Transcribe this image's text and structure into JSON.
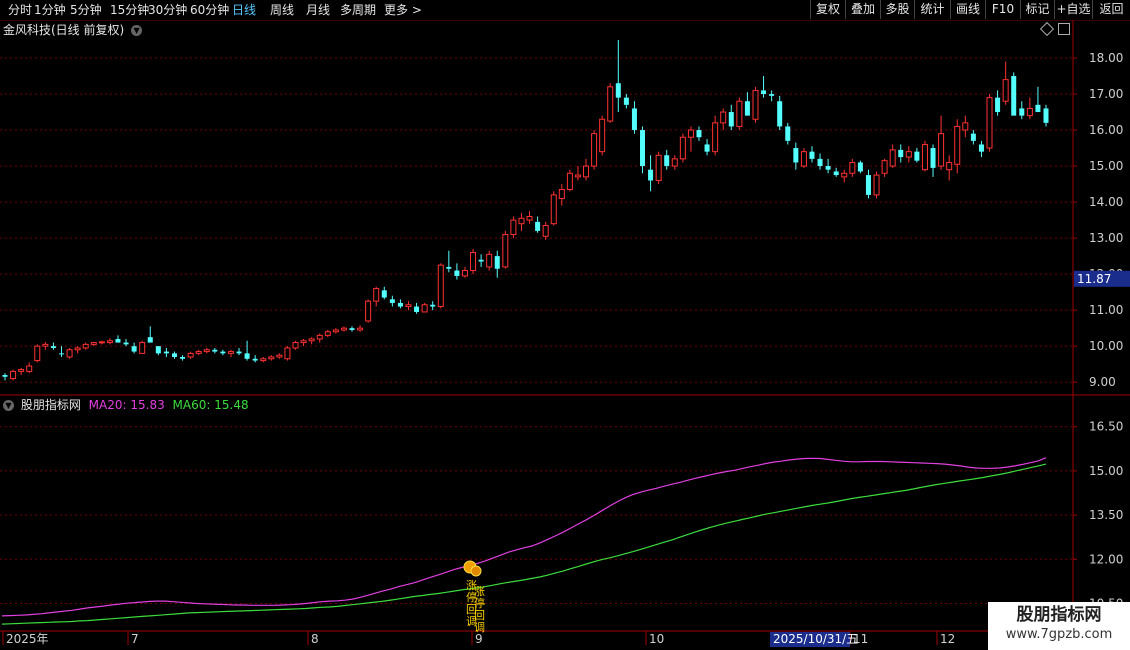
{
  "toolbar": {
    "periods": [
      "分时",
      "1分钟",
      "5分钟",
      "15分钟",
      "30分钟",
      "60分钟",
      "日线",
      "周线",
      "月线",
      "多周期",
      "更多 >"
    ],
    "active_period": "日线",
    "buttons": [
      "复权",
      "叠加",
      "多股",
      "统计",
      "画线",
      "F10",
      "标记",
      "+自选",
      "返回"
    ]
  },
  "stock_title": "金风科技(日线 前复权)",
  "indicator": {
    "name": "股朋指标网",
    "ma20_label": "MA20: 15.83",
    "ma60_label": "MA60: 15.48"
  },
  "colors": {
    "up": "#ff3232",
    "down": "#54ffff",
    "ma20": "#e040e0",
    "ma60": "#3cdc3c",
    "grid": "#6a0000",
    "axis_text": "#d0d0d0",
    "signal": "#ffd200"
  },
  "price_axis": {
    "labels": [
      "18.00",
      "17.00",
      "16.00",
      "15.00",
      "14.00",
      "13.00",
      "12.00",
      "11.00",
      "10.00",
      "9.00"
    ],
    "min": 8.7,
    "max": 18.5,
    "current_price": "11.87"
  },
  "indicator_axis": {
    "labels": [
      "16.50",
      "15.00",
      "13.50",
      "12.00",
      "10.50"
    ],
    "min": 9.6,
    "max": 17.0
  },
  "time_axis": [
    "2025年",
    "7",
    "8",
    "9",
    "10",
    "11",
    "12"
  ],
  "cursor_date": "2025/10/31/五",
  "signal_text": [
    "涨",
    "停",
    "回",
    "调"
  ],
  "watermark": {
    "name": "股朋指标网",
    "url": "www.7gpzb.com"
  },
  "chart_data": {
    "type": "candlestick",
    "candles": [
      [
        9.2,
        9.25,
        9.05,
        9.15
      ],
      [
        9.1,
        9.35,
        9.05,
        9.3
      ],
      [
        9.3,
        9.4,
        9.2,
        9.35
      ],
      [
        9.3,
        9.55,
        9.25,
        9.45
      ],
      [
        9.6,
        10.05,
        9.55,
        10.0
      ],
      [
        10.0,
        10.12,
        9.9,
        10.05
      ],
      [
        10.0,
        10.1,
        9.9,
        9.95
      ],
      [
        9.8,
        10.0,
        9.7,
        9.78
      ],
      [
        9.7,
        9.95,
        9.65,
        9.9
      ],
      [
        9.9,
        10.0,
        9.8,
        9.95
      ],
      [
        9.95,
        10.1,
        9.9,
        10.05
      ],
      [
        10.05,
        10.12,
        10.0,
        10.1
      ],
      [
        10.1,
        10.15,
        10.05,
        10.12
      ],
      [
        10.1,
        10.22,
        10.05,
        10.15
      ],
      [
        10.2,
        10.3,
        10.1,
        10.1
      ],
      [
        10.1,
        10.2,
        10.0,
        10.05
      ],
      [
        10.0,
        10.1,
        9.8,
        9.85
      ],
      [
        9.8,
        10.15,
        9.8,
        10.1
      ],
      [
        10.25,
        10.55,
        10.1,
        10.1
      ],
      [
        10.0,
        10.0,
        9.75,
        9.8
      ],
      [
        9.85,
        9.95,
        9.7,
        9.8
      ],
      [
        9.8,
        9.85,
        9.65,
        9.7
      ],
      [
        9.7,
        9.75,
        9.6,
        9.65
      ],
      [
        9.7,
        9.85,
        9.65,
        9.8
      ],
      [
        9.8,
        9.9,
        9.75,
        9.85
      ],
      [
        9.85,
        9.95,
        9.8,
        9.9
      ],
      [
        9.9,
        9.95,
        9.8,
        9.85
      ],
      [
        9.85,
        9.9,
        9.75,
        9.8
      ],
      [
        9.8,
        9.9,
        9.7,
        9.85
      ],
      [
        9.85,
        9.95,
        9.75,
        9.8
      ],
      [
        9.8,
        10.15,
        9.6,
        9.65
      ],
      [
        9.65,
        9.75,
        9.55,
        9.6
      ],
      [
        9.6,
        9.7,
        9.55,
        9.65
      ],
      [
        9.65,
        9.75,
        9.6,
        9.7
      ],
      [
        9.7,
        9.8,
        9.65,
        9.75
      ],
      [
        9.65,
        10.0,
        9.6,
        9.95
      ],
      [
        9.95,
        10.15,
        9.9,
        10.1
      ],
      [
        10.1,
        10.2,
        10.0,
        10.15
      ],
      [
        10.15,
        10.25,
        10.05,
        10.2
      ],
      [
        10.2,
        10.35,
        10.1,
        10.3
      ],
      [
        10.3,
        10.45,
        10.25,
        10.4
      ],
      [
        10.4,
        10.5,
        10.35,
        10.45
      ],
      [
        10.45,
        10.55,
        10.4,
        10.5
      ],
      [
        10.5,
        10.55,
        10.4,
        10.45
      ],
      [
        10.45,
        10.58,
        10.4,
        10.5
      ],
      [
        10.7,
        11.3,
        10.65,
        11.25
      ],
      [
        11.25,
        11.65,
        11.1,
        11.6
      ],
      [
        11.55,
        11.65,
        11.3,
        11.35
      ],
      [
        11.3,
        11.4,
        11.1,
        11.2
      ],
      [
        11.2,
        11.3,
        11.05,
        11.1
      ],
      [
        11.1,
        11.25,
        11.0,
        11.15
      ],
      [
        11.1,
        11.2,
        10.9,
        10.95
      ],
      [
        10.95,
        11.2,
        10.95,
        11.15
      ],
      [
        11.15,
        11.25,
        11.0,
        11.1
      ],
      [
        11.1,
        12.3,
        11.05,
        12.25
      ],
      [
        12.2,
        12.65,
        12.05,
        12.15
      ],
      [
        12.1,
        12.3,
        11.85,
        11.95
      ],
      [
        11.95,
        12.2,
        11.9,
        12.1
      ],
      [
        12.1,
        12.7,
        12.0,
        12.6
      ],
      [
        12.4,
        12.55,
        12.2,
        12.35
      ],
      [
        12.2,
        12.65,
        12.1,
        12.55
      ],
      [
        12.5,
        12.65,
        11.9,
        12.15
      ],
      [
        12.2,
        13.2,
        12.15,
        13.1
      ],
      [
        13.1,
        13.6,
        13.0,
        13.5
      ],
      [
        13.4,
        13.7,
        13.2,
        13.55
      ],
      [
        13.5,
        13.75,
        13.4,
        13.6
      ],
      [
        13.45,
        13.6,
        13.15,
        13.2
      ],
      [
        13.05,
        13.45,
        12.95,
        13.35
      ],
      [
        13.4,
        14.3,
        13.35,
        14.2
      ],
      [
        14.1,
        14.5,
        13.9,
        14.35
      ],
      [
        14.35,
        14.9,
        14.3,
        14.8
      ],
      [
        14.7,
        15.0,
        14.6,
        14.75
      ],
      [
        14.7,
        15.2,
        14.6,
        15.0
      ],
      [
        15.0,
        16.0,
        14.9,
        15.9
      ],
      [
        15.4,
        16.4,
        15.3,
        16.3
      ],
      [
        16.25,
        17.3,
        16.2,
        17.2
      ],
      [
        17.3,
        18.5,
        16.5,
        16.9
      ],
      [
        16.9,
        17.0,
        16.6,
        16.7
      ],
      [
        16.6,
        16.8,
        15.9,
        16.0
      ],
      [
        16.0,
        16.1,
        14.8,
        15.0
      ],
      [
        14.9,
        15.3,
        14.3,
        14.6
      ],
      [
        14.6,
        15.4,
        14.5,
        15.3
      ],
      [
        15.3,
        15.45,
        14.9,
        15.0
      ],
      [
        15.0,
        15.3,
        14.9,
        15.2
      ],
      [
        15.2,
        15.9,
        15.1,
        15.8
      ],
      [
        15.8,
        16.1,
        15.4,
        16.0
      ],
      [
        16.0,
        16.1,
        15.7,
        15.8
      ],
      [
        15.6,
        15.75,
        15.3,
        15.4
      ],
      [
        15.4,
        16.4,
        15.3,
        16.2
      ],
      [
        16.2,
        16.6,
        16.0,
        16.5
      ],
      [
        16.5,
        16.7,
        16.0,
        16.1
      ],
      [
        16.1,
        16.9,
        16.0,
        16.8
      ],
      [
        16.8,
        17.05,
        16.6,
        16.4
      ],
      [
        16.3,
        17.2,
        16.2,
        17.1
      ],
      [
        17.1,
        17.5,
        16.9,
        17.0
      ],
      [
        17.0,
        17.1,
        16.8,
        16.95
      ],
      [
        16.8,
        16.95,
        16.0,
        16.1
      ],
      [
        16.1,
        16.2,
        15.6,
        15.7
      ],
      [
        15.5,
        15.65,
        14.9,
        15.1
      ],
      [
        15.0,
        15.5,
        14.95,
        15.4
      ],
      [
        15.4,
        15.55,
        15.1,
        15.2
      ],
      [
        15.2,
        15.35,
        14.9,
        15.0
      ],
      [
        15.0,
        15.2,
        14.8,
        14.9
      ],
      [
        14.85,
        14.95,
        14.7,
        14.75
      ],
      [
        14.7,
        14.9,
        14.55,
        14.8
      ],
      [
        14.8,
        15.2,
        14.7,
        15.1
      ],
      [
        15.1,
        15.15,
        14.8,
        14.85
      ],
      [
        14.75,
        14.9,
        14.1,
        14.2
      ],
      [
        14.2,
        14.85,
        14.1,
        14.75
      ],
      [
        14.8,
        15.2,
        14.7,
        15.15
      ],
      [
        15.0,
        15.6,
        14.95,
        15.45
      ],
      [
        15.45,
        15.6,
        15.1,
        15.25
      ],
      [
        15.25,
        15.55,
        15.1,
        15.4
      ],
      [
        15.4,
        15.5,
        15.1,
        15.15
      ],
      [
        14.9,
        15.7,
        14.85,
        15.6
      ],
      [
        15.5,
        15.6,
        14.7,
        14.95
      ],
      [
        15.0,
        16.4,
        14.9,
        15.9
      ],
      [
        14.9,
        15.3,
        14.6,
        15.1
      ],
      [
        15.05,
        16.3,
        14.8,
        16.1
      ],
      [
        16.0,
        16.4,
        15.8,
        16.2
      ],
      [
        15.9,
        16.0,
        15.6,
        15.7
      ],
      [
        15.6,
        15.7,
        15.25,
        15.4
      ],
      [
        15.5,
        17.0,
        15.4,
        16.9
      ],
      [
        16.9,
        17.1,
        16.4,
        16.5
      ],
      [
        16.8,
        17.9,
        16.7,
        17.4
      ],
      [
        17.5,
        17.6,
        16.6,
        16.4
      ],
      [
        16.6,
        16.8,
        16.3,
        16.4
      ],
      [
        16.4,
        16.9,
        16.3,
        16.6
      ],
      [
        16.7,
        17.2,
        16.5,
        16.5
      ],
      [
        16.6,
        16.7,
        16.1,
        16.2
      ]
    ],
    "ma20": [
      10.08,
      10.09,
      10.1,
      10.11,
      10.13,
      10.15,
      10.18,
      10.21,
      10.24,
      10.27,
      10.31,
      10.35,
      10.38,
      10.41,
      10.45,
      10.48,
      10.51,
      10.53,
      10.55,
      10.57,
      10.58,
      10.58,
      10.56,
      10.54,
      10.52,
      10.5,
      10.49,
      10.48,
      10.47,
      10.46,
      10.45,
      10.45,
      10.44,
      10.44,
      10.44,
      10.44,
      10.45,
      10.46,
      10.48,
      10.5,
      10.53,
      10.56,
      10.58,
      10.59,
      10.61,
      10.65,
      10.71,
      10.78,
      10.86,
      10.93,
      11.0,
      11.08,
      11.14,
      11.21,
      11.3,
      11.39,
      11.47,
      11.56,
      11.65,
      11.72,
      11.79,
      11.86,
      11.94,
      12.04,
      12.14,
      12.24,
      12.32,
      12.39,
      12.45,
      12.55,
      12.67,
      12.79,
      12.92,
      13.06,
      13.2,
      13.34,
      13.49,
      13.65,
      13.81,
      13.96,
      14.09,
      14.2,
      14.28,
      14.35,
      14.41,
      14.48,
      14.55,
      14.61,
      14.68,
      14.75,
      14.81,
      14.87,
      14.93,
      14.98,
      15.02,
      15.08,
      15.14,
      15.19,
      15.25,
      15.3,
      15.33,
      15.37,
      15.4,
      15.42,
      15.43,
      15.42,
      15.39,
      15.36,
      15.33,
      15.31,
      15.31,
      15.32,
      15.32,
      15.32,
      15.31,
      15.3,
      15.29,
      15.28,
      15.27,
      15.26,
      15.25,
      15.23,
      15.2,
      15.17,
      15.13,
      15.1,
      15.09,
      15.09,
      15.1,
      15.13,
      15.17,
      15.22,
      15.28,
      15.34,
      15.45
    ],
    "ma60": [
      9.8,
      9.81,
      9.82,
      9.83,
      9.84,
      9.85,
      9.86,
      9.87,
      9.88,
      9.89,
      9.91,
      9.92,
      9.94,
      9.96,
      9.98,
      10.0,
      10.02,
      10.04,
      10.06,
      10.08,
      10.1,
      10.12,
      10.14,
      10.16,
      10.18,
      10.19,
      10.2,
      10.21,
      10.22,
      10.23,
      10.24,
      10.25,
      10.26,
      10.27,
      10.28,
      10.29,
      10.3,
      10.31,
      10.32,
      10.33,
      10.35,
      10.37,
      10.38,
      10.4,
      10.43,
      10.46,
      10.49,
      10.52,
      10.55,
      10.58,
      10.62,
      10.66,
      10.7,
      10.74,
      10.77,
      10.81,
      10.84,
      10.88,
      10.92,
      10.96,
      11.0,
      11.03,
      11.07,
      11.12,
      11.17,
      11.22,
      11.26,
      11.3,
      11.35,
      11.4,
      11.46,
      11.53,
      11.6,
      11.68,
      11.76,
      11.84,
      11.92,
      11.99,
      12.05,
      12.12,
      12.19,
      12.26,
      12.34,
      12.42,
      12.5,
      12.58,
      12.66,
      12.75,
      12.84,
      12.93,
      13.01,
      13.09,
      13.16,
      13.23,
      13.29,
      13.35,
      13.41,
      13.47,
      13.53,
      13.58,
      13.63,
      13.68,
      13.73,
      13.78,
      13.83,
      13.87,
      13.91,
      13.96,
      14.01,
      14.06,
      14.1,
      14.14,
      14.18,
      14.22,
      14.26,
      14.3,
      14.34,
      14.39,
      14.44,
      14.49,
      14.54,
      14.58,
      14.62,
      14.66,
      14.7,
      14.74,
      14.78,
      14.83,
      14.88,
      14.93,
      14.99,
      15.05,
      15.11,
      15.17,
      15.23
    ]
  }
}
